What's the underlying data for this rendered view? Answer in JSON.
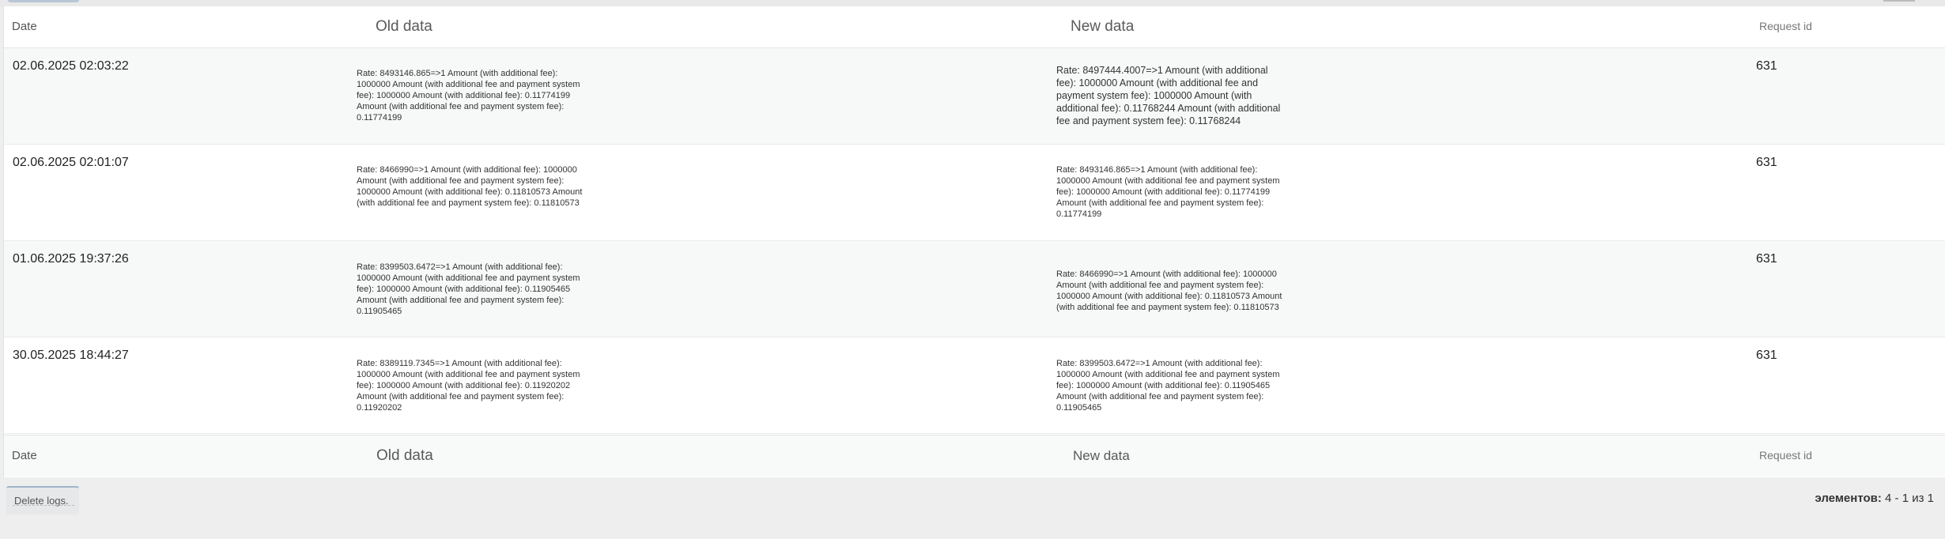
{
  "columns": {
    "date": "Date",
    "old": "Old data",
    "new": "New data",
    "request": "Request id"
  },
  "rows": [
    {
      "date": "02.06.2025 02:03:22",
      "old": "Rate: 8493146.865=>1 Amount (with additional fee): 1000000 Amount (with additional fee and payment system fee): 1000000 Amount (with additional fee): 0.11774199 Amount (with additional fee and payment system fee): 0.11774199",
      "new": "Rate: 8497444.4007=>1 Amount (with additional fee): 1000000 Amount (with additional fee and payment system fee): 1000000 Amount (with additional fee): 0.11768244 Amount (with additional fee and payment system fee): 0.11768244",
      "request": "631"
    },
    {
      "date": "02.06.2025 02:01:07",
      "old": "Rate: 8466990=>1 Amount (with additional fee): 1000000 Amount (with additional fee and payment system fee): 1000000 Amount (with additional fee): 0.11810573 Amount (with additional fee and payment system fee): 0.11810573",
      "new": "Rate: 8493146.865=>1 Amount (with additional fee): 1000000 Amount (with additional fee and payment system fee): 1000000 Amount (with additional fee): 0.11774199 Amount (with additional fee and payment system fee): 0.11774199",
      "request": "631"
    },
    {
      "date": "01.06.2025 19:37:26",
      "old": "Rate: 8399503.6472=>1 Amount (with additional fee): 1000000 Amount (with additional fee and payment system fee): 1000000 Amount (with additional fee): 0.11905465 Amount (with additional fee and payment system fee): 0.11905465",
      "new": "Rate: 8466990=>1 Amount (with additional fee): 1000000 Amount (with additional fee and payment system fee): 1000000 Amount (with additional fee): 0.11810573 Amount (with additional fee and payment system fee): 0.11810573",
      "request": "631"
    },
    {
      "date": "30.05.2025 18:44:27",
      "old": "Rate: 8389119.7345=>1 Amount (with additional fee): 1000000 Amount (with additional fee and payment system fee): 1000000 Amount (with additional fee): 0.11920202 Amount (with additional fee and payment system fee): 0.11920202",
      "new": "Rate: 8399503.6472=>1 Amount (with additional fee): 1000000 Amount (with additional fee and payment system fee): 1000000 Amount (with additional fee): 0.11905465 Amount (with additional fee and payment system fee): 0.11905465",
      "request": "631"
    }
  ],
  "footer": {
    "delete_label": "Delete logs.",
    "pager_prefix": "элементов:",
    "pager_range": "4 - 1",
    "pager_of": "из",
    "pager_total": "1"
  }
}
